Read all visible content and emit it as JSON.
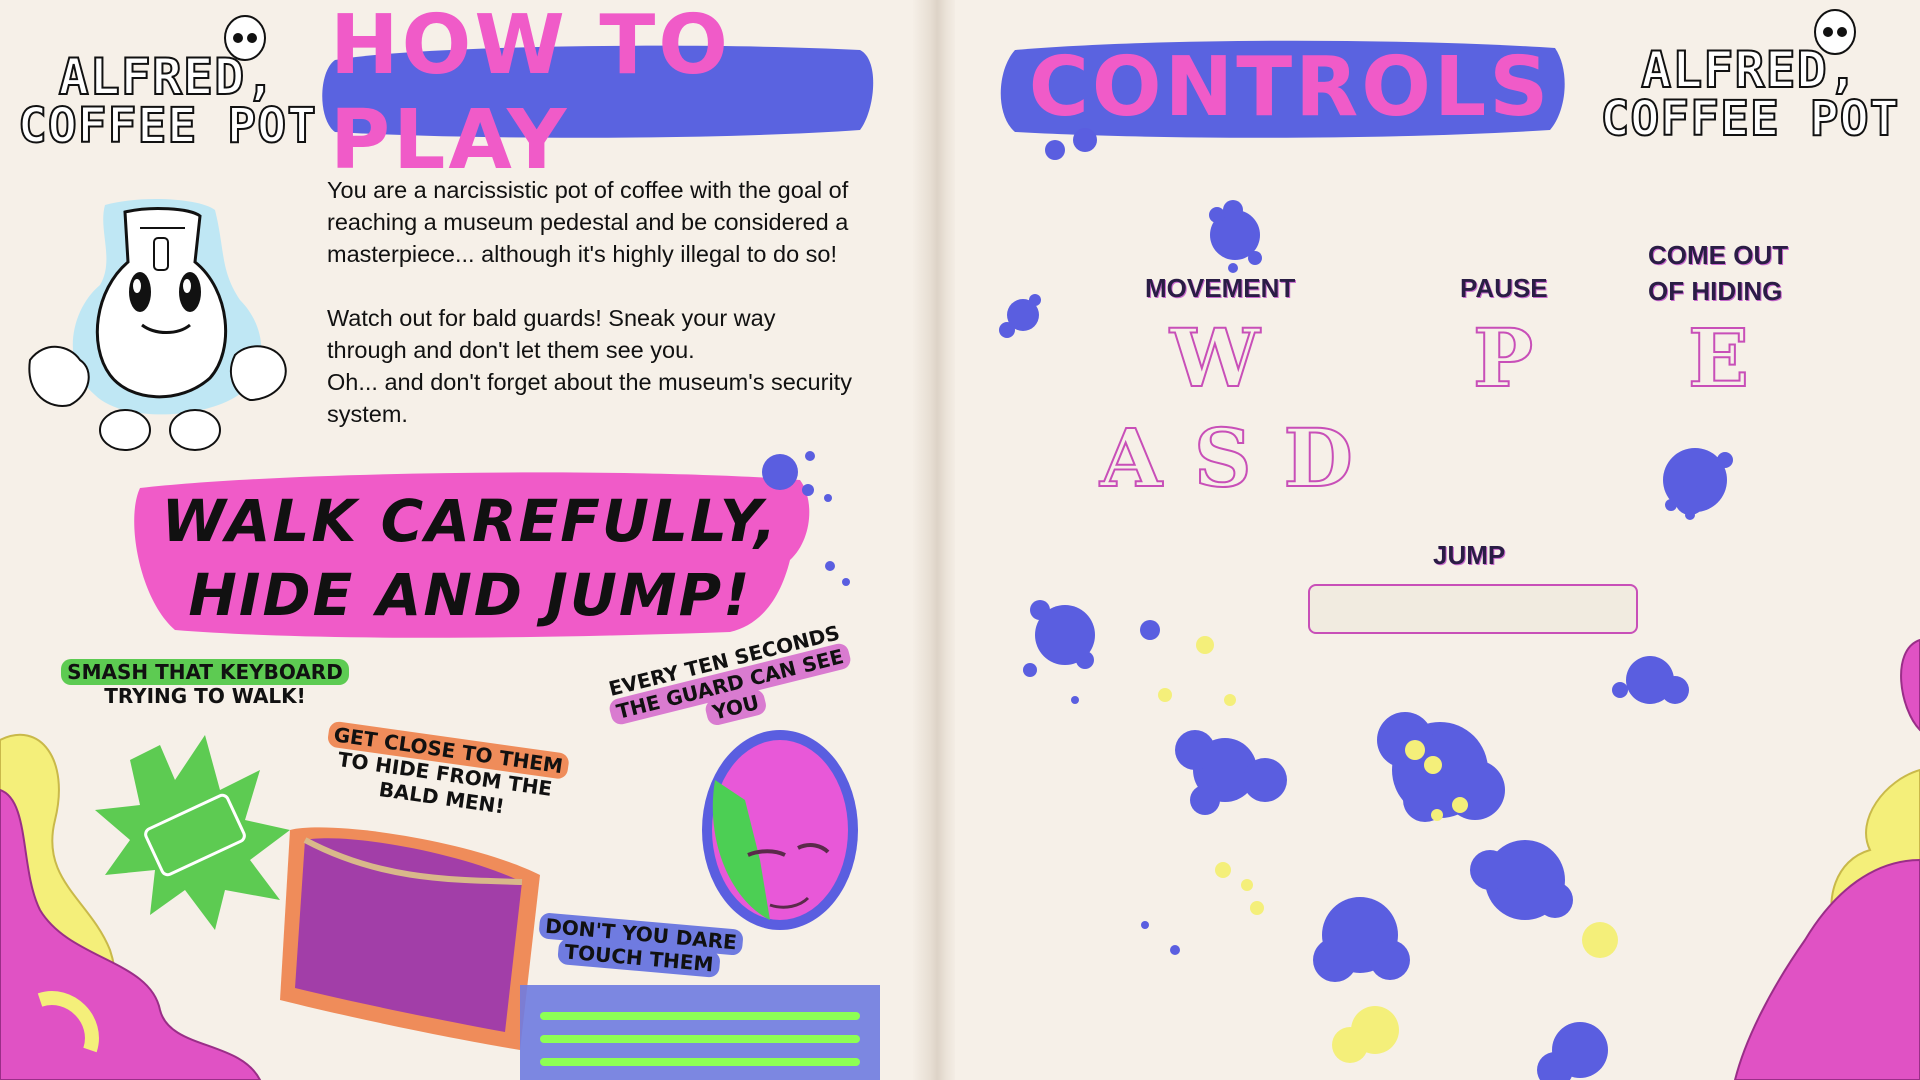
{
  "left_page": {
    "logo": {
      "line1": "ALFRED,",
      "line2": "COFFEE POT"
    },
    "heading": "HOW TO PLAY",
    "intro": "You are a narcissistic pot of coffee with the goal of\nreaching a museum pedestal and be considered a\nmasterpiece... although it's highly illegal to do so!\n\nWatch out for bald guards! Sneak your way\nthrough and don't let them see you.\nOh... and don't forget about the museum's security\nsystem.",
    "slogan": {
      "line1": "WALK CAREFULLY,",
      "line2": "HIDE AND JUMP!"
    },
    "tips": {
      "keyboard": {
        "line1": "SMASH THAT KEYBOARD",
        "line2": "TRYING TO WALK!"
      },
      "hide": {
        "line1": "GET CLOSE TO THEM",
        "line2": "TO HIDE FROM THE",
        "line3": "BALD MEN!"
      },
      "guard": {
        "line1": "EVERY TEN SECONDS",
        "line2": "THE GUARD CAN SEE",
        "line3": "YOU"
      },
      "laser": {
        "line1": "DON'T YOU DARE",
        "line2": "TOUCH THEM"
      }
    }
  },
  "right_page": {
    "logo": {
      "line1": "ALFRED,",
      "line2": "COFFEE POT"
    },
    "heading": "CONTROLS",
    "controls": {
      "movement": {
        "label": "MOVEMENT",
        "keys_top": "W",
        "keys_bottom": "A S D"
      },
      "pause": {
        "label": "PAUSE",
        "key": "P"
      },
      "hide": {
        "label_line1": "COME OUT",
        "label_line2": "OF HIDING",
        "key": "E"
      },
      "jump": {
        "label": "JUMP"
      }
    }
  },
  "colors": {
    "page": "#f6f0e8",
    "banner_blue": "#5a63e0",
    "banner_text_pink": "#f05bc8",
    "magenta_blob": "#e052c4",
    "yellow_blob": "#f4ef7a",
    "splat_blue": "#5a5ee0",
    "tip_green": "#5dcb52",
    "tip_orange": "#ef8c5a",
    "tip_pink": "#d97bd0",
    "tip_blue": "#6f7be0",
    "key_outline": "#c84fb8"
  }
}
